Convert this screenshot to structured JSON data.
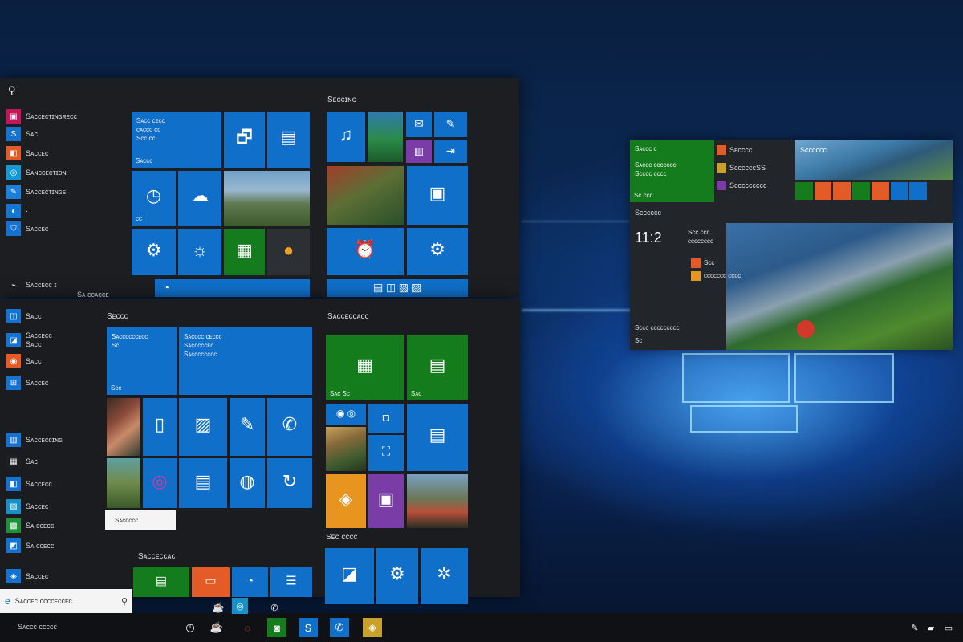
{
  "theme": {
    "accent": "#0f6fc9",
    "green": "#157c1e",
    "orange": "#e8951f",
    "purple": "#7a3da8",
    "red": "#e35c27",
    "menu_bg": "#1c1e22",
    "taskbar_bg": "#101114"
  },
  "top_menu": {
    "applist": [
      {
        "icon": "app-icon",
        "label": "Sᴀᴄᴄᴇᴄᴛɪɴɢʀᴇᴄᴄ"
      },
      {
        "icon": "app-icon",
        "label": "Sᴀᴄ"
      },
      {
        "icon": "app-icon",
        "label": "Sᴀᴄᴄᴇᴄ"
      },
      {
        "icon": "app-icon",
        "label": "Sᴀɴᴄᴄᴇᴄᴛɪᴏɴ"
      },
      {
        "icon": "app-icon",
        "label": "Sᴀᴄᴄᴇᴄᴛɪɴɢᴇ"
      },
      {
        "icon": "app-icon",
        "label": "·"
      },
      {
        "icon": "app-icon",
        "label": "Sᴀᴄᴄᴇᴄ"
      },
      {
        "icon": "power-icon",
        "label": "Sᴀᴄᴄᴇᴄᴄ ɪ"
      }
    ],
    "bottom_text": "Sᴀ ᴄᴄᴀᴄᴄᴇ",
    "group_right_title": "Sᴇᴄᴄɪɴɢ",
    "tile_news_text": "Sᴀᴄᴄ ᴄᴇᴄᴄ\nᴄᴀᴄᴄᴄ ᴄᴄ\nSᴄᴄ ᴄᴄ",
    "tile_news_label": "Sᴀᴄᴄᴄ",
    "tile_small_label": "ᴄᴄ"
  },
  "bottom_menu": {
    "applist": [
      {
        "icon": "app-icon",
        "label": "Sᴀᴄᴄ"
      },
      {
        "icon": "app-icon",
        "label": "Sᴀᴄᴄᴇᴄᴄ\nSᴀᴄᴄ"
      },
      {
        "icon": "app-icon",
        "label": "Sᴀᴄᴄ"
      },
      {
        "icon": "app-icon",
        "label": "Sᴀᴄᴄᴇᴄ"
      },
      {
        "icon": "app-icon",
        "label": "Sᴀᴄᴄᴇᴄᴄɪɴɢ"
      },
      {
        "icon": "app-icon",
        "label": "Sᴀᴄ"
      },
      {
        "icon": "app-icon",
        "label": "Sᴀᴄᴄᴇᴄᴄ"
      },
      {
        "icon": "app-icon",
        "label": "Sᴀᴄᴄᴇᴄ"
      },
      {
        "icon": "app-icon",
        "label": "Sᴀ ᴄᴄᴇᴄᴄ"
      },
      {
        "icon": "app-icon",
        "label": "Sᴀ ᴄᴄᴇᴄᴄ"
      },
      {
        "icon": "app-icon",
        "label": "Sᴀᴄᴄᴇᴄ"
      }
    ],
    "group_left_title": "Sᴇᴄᴄᴄ",
    "group_right_title": "Sᴀᴄᴄᴇᴄᴄᴀᴄᴄ",
    "group_lower_title": "Sᴇᴄ ᴄᴄᴄᴄ",
    "group_bottom_title": "Sᴀᴄᴄᴇᴄᴄᴀᴄ",
    "tile_a_text": "Sᴀᴄᴄᴄᴄᴄᴄᴇᴄᴄ\nSᴄ",
    "tile_a_label": "Sᴄᴄ",
    "tile_b_text": "Sᴀᴄᴄᴄᴄ ᴄᴇᴄᴄᴄ\nSᴀᴄᴄᴄᴄᴄᴇᴄ\nSᴀᴄᴄᴄᴄᴄᴄᴄᴄ",
    "tile_green1_label": "Sᴀᴄ Sᴄ",
    "tile_green2_label": "Sᴀᴄ",
    "small_panel_text": "Sᴀᴄᴄᴄᴄᴄ"
  },
  "search": {
    "placeholder": "Sᴀᴄᴄᴇᴄ ᴄᴄᴄᴄᴇᴄᴄᴇᴄ",
    "glyph": "⚲"
  },
  "widget": {
    "tile_title": "Sᴀᴄᴄᴄ ᴄ",
    "tile_sub": "Sᴀᴄᴄᴄ ᴄᴄᴄᴄᴄᴄᴄ\nSᴄᴄᴄᴄ ᴄᴄᴄᴄ",
    "tile_bottom": "Sᴄ ᴄᴄᴄ",
    "list": [
      "Sᴇᴄᴄᴄᴄ",
      "SᴄᴄᴄᴄᴄᴄSS",
      "Sᴄᴄᴄᴄᴄᴄᴄᴄᴄ"
    ],
    "photo_title": "Sᴄᴄᴄᴄᴄᴄ",
    "section": "Sᴄᴄᴄᴄᴄᴄ",
    "time": "11:2",
    "info_lines": [
      "Sᴄᴄ ᴄᴄᴄ",
      "ᴄᴄᴄᴄᴄᴄᴄᴄ",
      "Sᴄᴄ",
      "ᴄᴄᴄᴄᴄᴄᴄ ᴄᴄᴄᴄ"
    ],
    "footer": "Sᴄᴄᴄ ᴄᴄᴄᴄᴄᴄᴄᴄᴄ",
    "footer2": "Sᴄ"
  },
  "taskbar": {
    "left_text": "Sᴀᴄᴄᴄ ᴄᴄᴄᴄᴄ"
  }
}
